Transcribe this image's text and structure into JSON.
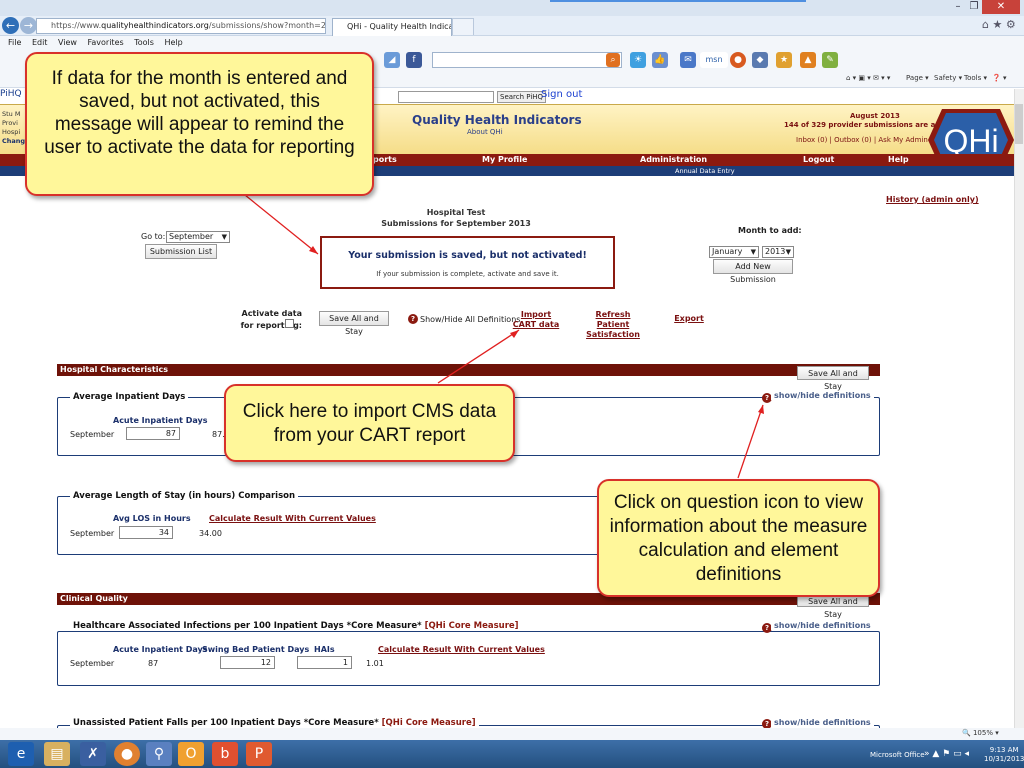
{
  "browser": {
    "url_prefix": "https://www.",
    "url_host": "qualityhealthindicators.org",
    "url_path": "/submissions/show?month=2013-09-01",
    "tab_title": "QHi - Quality Health Indica...",
    "menu": [
      "File",
      "Edit",
      "View",
      "Favorites",
      "Tools",
      "Help"
    ],
    "toolbar_small": [
      "Page ▾",
      "Safety ▾",
      "Tools ▾"
    ],
    "zoom": "105%"
  },
  "site": {
    "pihq_label": "PiHQ",
    "search_button": "Search PiHQ",
    "signout": "Sign out",
    "user_lines": [
      "Stu M",
      "Provi",
      "Hospi",
      "Chang"
    ],
    "title": "Quality Health Indicators",
    "about": "About QHi",
    "month": "August 2013",
    "activated_count": "144 of 329 provider submissions are activated",
    "inbox_links": "Inbox (0) | Outbox (0) | Ask My Admin",
    "logo_text": "QHi",
    "nav": [
      "ports",
      "My Profile",
      "Administration",
      "Logout",
      "Help"
    ],
    "subnav": "Annual Data Entry",
    "history_link": "History (admin only)"
  },
  "submission": {
    "hospital": "Hospital Test",
    "subtitle": "Submissions for September 2013",
    "goto_label": "Go to:",
    "goto_value": "September",
    "submission_list": "Submission List",
    "alert_main": "Your submission is saved, but not activated!",
    "alert_sub": "If your submission is complete, activate and save it.",
    "month_to_add": "Month to add:",
    "add_month": "January",
    "add_year": "2013",
    "add_button": "Add New Submission",
    "activate_label": "Activate data for reporting:",
    "save_all": "Save All and Stay",
    "show_hide_all": "Show/Hide All Definitions",
    "import_cart": "Import CART data",
    "refresh_patient": "Refresh Patient Satisfaction",
    "export": "Export"
  },
  "sections": {
    "hospital_characteristics": "Hospital Characteristics",
    "clinical_quality": "Clinical Quality",
    "save_all": "Save All and Stay",
    "show_hide": "show/hide definitions"
  },
  "measures": {
    "avg_inpatient": {
      "title": "Average Inpatient Days",
      "col": "Acute Inpatient Days",
      "row_label": "September",
      "value": "87",
      "result": "87.0"
    },
    "avg_los": {
      "title": "Average Length of Stay (in hours) Comparison",
      "col": "Avg LOS in Hours",
      "calc": "Calculate Result With Current Values",
      "row_label": "September",
      "value": "34",
      "result": "34.00"
    },
    "hai": {
      "title": "Healthcare Associated Infections per 100 Inpatient Days *Core Measure*",
      "core": "[QHi Core Measure]",
      "cols": [
        "Acute Inpatient Days",
        "Swing Bed Patient Days",
        "HAIs"
      ],
      "calc": "Calculate Result With Current Values",
      "row_label": "September",
      "acute": "87",
      "swing": "12",
      "hais": "1",
      "result": "1.01"
    },
    "falls": {
      "title": "Unassisted Patient Falls per 100 Inpatient Days *Core Measure*",
      "core": "[QHi Core Measure]"
    }
  },
  "callouts": {
    "activate": "If data for the month is entered and saved, but not activated, this message will appear to remind the user to activate the data for reporting",
    "cart": "Click here to import CMS data from your CART report",
    "question": "Click on question icon to view information about the measure calculation and element definitions"
  },
  "taskbar": {
    "office": "Microsoft Office",
    "time": "9:13 AM",
    "date": "10/31/2013"
  },
  "colors": {
    "accent_red": "#8b1a10",
    "navy": "#1d3d78",
    "callout_fill": "#fff79a",
    "callout_border": "#d8312a"
  }
}
